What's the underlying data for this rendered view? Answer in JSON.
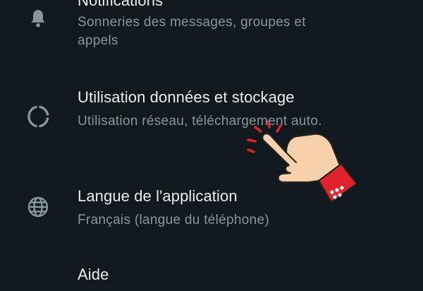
{
  "settings": {
    "items": [
      {
        "title": "Notifications",
        "subtitle": "Sonneries des messages, groupes et appels",
        "icon": "bell-icon"
      },
      {
        "title": "Utilisation données et stockage",
        "subtitle": "Utilisation réseau, téléchargement auto.",
        "icon": "data-usage-icon"
      },
      {
        "title": "Langue de l'application",
        "subtitle": "Français (langue du téléphone)",
        "icon": "globe-icon"
      },
      {
        "title": "Aide",
        "subtitle": "",
        "icon": "help-icon"
      }
    ]
  },
  "colors": {
    "background": "#12191e",
    "title_text": "#e9edef",
    "subtitle_text": "#8696a0",
    "icon": "#8696a0",
    "hand_skin": "#f7d1ab",
    "cuff": "#e0222a"
  },
  "overlay": {
    "icon": "tap-hand-icon"
  }
}
